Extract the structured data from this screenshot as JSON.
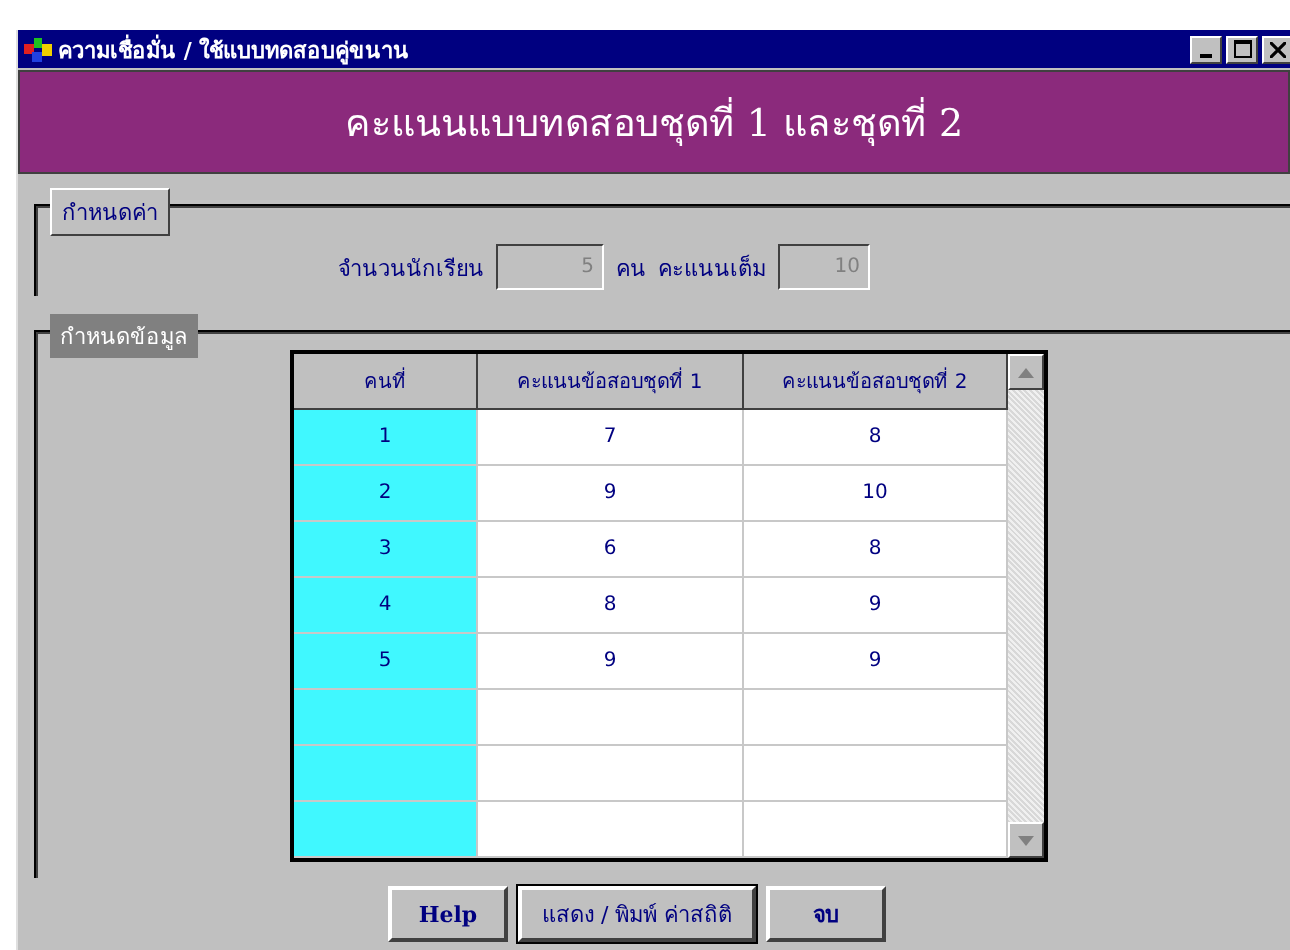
{
  "window": {
    "title": "ความเชื่อมั่น / ใช้แบบทดสอบคู่ขนาน"
  },
  "banner": "คะแนนแบบทดสอบชุดที่ 1 และชุดที่ 2",
  "settings": {
    "label": "กำหนดค่า",
    "students_label": "จำนวนนักเรียน",
    "students_value": "5",
    "unit": "คน",
    "full_score_label": "คะแนนเต็ม",
    "full_score_value": "10"
  },
  "data_group": {
    "label": "กำหนดข้อมูล"
  },
  "table": {
    "columns": [
      "คนที่",
      "คะแนนข้อสอบชุดที่ 1",
      "คะแนนข้อสอบชุดที่ 2"
    ],
    "rows": [
      [
        "1",
        "7",
        "8"
      ],
      [
        "2",
        "9",
        "10"
      ],
      [
        "3",
        "6",
        "8"
      ],
      [
        "4",
        "8",
        "9"
      ],
      [
        "5",
        "9",
        "9"
      ]
    ]
  },
  "buttons": [
    {
      "label": "Help",
      "focused": false
    },
    {
      "label": "แสดง / พิมพ์ ค่าสถิติ",
      "focused": true
    },
    {
      "label": "จบ",
      "focused": false
    }
  ]
}
